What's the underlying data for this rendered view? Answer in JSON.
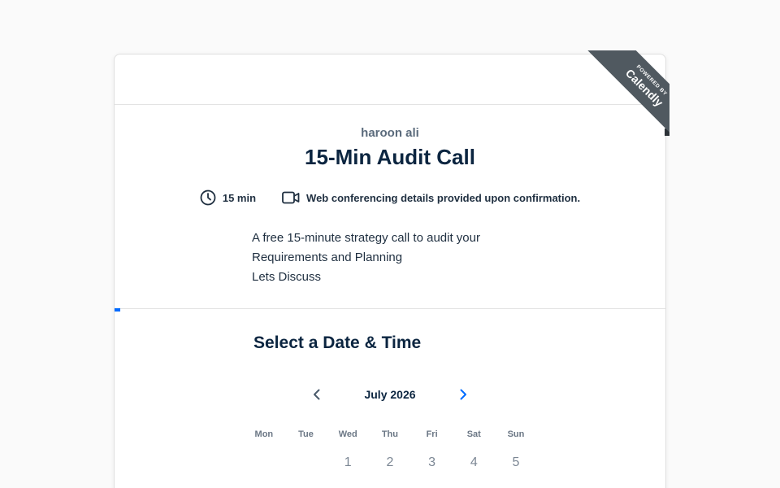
{
  "badge": {
    "line1": "POWERED BY",
    "line2": "Calendly"
  },
  "event": {
    "owner": "haroon ali",
    "title": "15-Min Audit Call",
    "duration": "15 min",
    "location": "Web conferencing details provided upon confirmation.",
    "description": [
      "A free 15-minute strategy call to audit your",
      "Requirements and Planning",
      "Lets Discuss"
    ]
  },
  "scheduler": {
    "heading": "Select a Date & Time",
    "month": "July 2026",
    "weekdays": [
      "Mon",
      "Tue",
      "Wed",
      "Thu",
      "Fri",
      "Sat",
      "Sun"
    ],
    "first_row_days": [
      "",
      "",
      "1",
      "2",
      "3",
      "4",
      "5"
    ]
  },
  "colors": {
    "accent": "#006bff",
    "title": "#0b2540",
    "badge": "#505960"
  }
}
